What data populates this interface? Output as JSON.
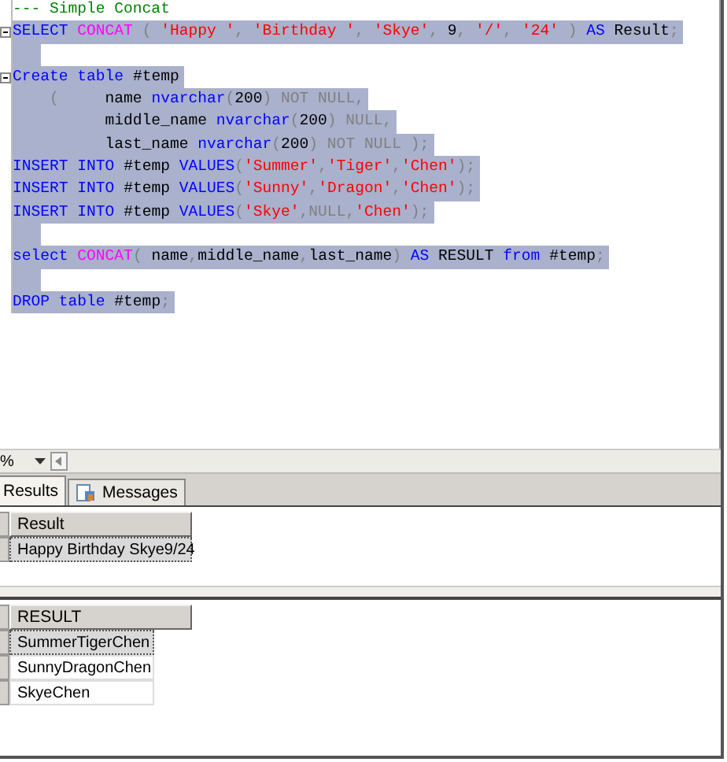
{
  "editor": {
    "lines": [
      {
        "selected": false,
        "tokens": [
          {
            "kind": "comment",
            "text": "--- Simple Concat"
          }
        ]
      },
      {
        "selected": true,
        "collapsible": true,
        "tokens": [
          {
            "kind": "keyword",
            "text": "SELECT "
          },
          {
            "kind": "function",
            "text": "CONCAT"
          },
          {
            "kind": "gray",
            "text": " ( "
          },
          {
            "kind": "string",
            "text": "'Happy '"
          },
          {
            "kind": "gray",
            "text": ", "
          },
          {
            "kind": "string",
            "text": "'Birthday '"
          },
          {
            "kind": "gray",
            "text": ", "
          },
          {
            "kind": "string",
            "text": "'Skye'"
          },
          {
            "kind": "gray",
            "text": ", "
          },
          {
            "kind": "plain",
            "text": "9"
          },
          {
            "kind": "gray",
            "text": ", "
          },
          {
            "kind": "string",
            "text": "'/'"
          },
          {
            "kind": "gray",
            "text": ", "
          },
          {
            "kind": "string",
            "text": "'24'"
          },
          {
            "kind": "gray",
            "text": " ) "
          },
          {
            "kind": "keyword",
            "text": "AS "
          },
          {
            "kind": "plain",
            "text": "Result"
          },
          {
            "kind": "gray",
            "text": ";"
          }
        ]
      },
      {
        "selected": true
      },
      {
        "selected": true,
        "collapsible": true,
        "tokens": [
          {
            "kind": "keyword",
            "text": "Create table "
          },
          {
            "kind": "plain",
            "text": "#temp"
          }
        ]
      },
      {
        "selected": true,
        "tokens": [
          {
            "kind": "gray",
            "text": "    (     "
          },
          {
            "kind": "plain",
            "text": "name "
          },
          {
            "kind": "keyword",
            "text": "nvarchar"
          },
          {
            "kind": "gray",
            "text": "("
          },
          {
            "kind": "plain",
            "text": "200"
          },
          {
            "kind": "gray",
            "text": ") NOT NULL,"
          }
        ]
      },
      {
        "selected": true,
        "tokens": [
          {
            "kind": "plain",
            "text": "          middle_name "
          },
          {
            "kind": "keyword",
            "text": "nvarchar"
          },
          {
            "kind": "gray",
            "text": "("
          },
          {
            "kind": "plain",
            "text": "200"
          },
          {
            "kind": "gray",
            "text": ") NULL,"
          }
        ]
      },
      {
        "selected": true,
        "tokens": [
          {
            "kind": "plain",
            "text": "          last_name "
          },
          {
            "kind": "keyword",
            "text": "nvarchar"
          },
          {
            "kind": "gray",
            "text": "("
          },
          {
            "kind": "plain",
            "text": "200"
          },
          {
            "kind": "gray",
            "text": ") NOT NULL );"
          }
        ]
      },
      {
        "selected": true,
        "tokens": [
          {
            "kind": "keyword",
            "text": "INSERT INTO "
          },
          {
            "kind": "plain",
            "text": "#temp "
          },
          {
            "kind": "keyword",
            "text": "VALUES"
          },
          {
            "kind": "gray",
            "text": "("
          },
          {
            "kind": "string",
            "text": "'Summer'"
          },
          {
            "kind": "gray",
            "text": ","
          },
          {
            "kind": "string",
            "text": "'Tiger'"
          },
          {
            "kind": "gray",
            "text": ","
          },
          {
            "kind": "string",
            "text": "'Chen'"
          },
          {
            "kind": "gray",
            "text": ");"
          }
        ]
      },
      {
        "selected": true,
        "tokens": [
          {
            "kind": "keyword",
            "text": "INSERT INTO "
          },
          {
            "kind": "plain",
            "text": "#temp "
          },
          {
            "kind": "keyword",
            "text": "VALUES"
          },
          {
            "kind": "gray",
            "text": "("
          },
          {
            "kind": "string",
            "text": "'Sunny'"
          },
          {
            "kind": "gray",
            "text": ","
          },
          {
            "kind": "string",
            "text": "'Dragon'"
          },
          {
            "kind": "gray",
            "text": ","
          },
          {
            "kind": "string",
            "text": "'Chen'"
          },
          {
            "kind": "gray",
            "text": ");"
          }
        ]
      },
      {
        "selected": true,
        "tokens": [
          {
            "kind": "keyword",
            "text": "INSERT INTO "
          },
          {
            "kind": "plain",
            "text": "#temp "
          },
          {
            "kind": "keyword",
            "text": "VALUES"
          },
          {
            "kind": "gray",
            "text": "("
          },
          {
            "kind": "string",
            "text": "'Skye'"
          },
          {
            "kind": "gray",
            "text": ",NULL,"
          },
          {
            "kind": "string",
            "text": "'Chen'"
          },
          {
            "kind": "gray",
            "text": ");"
          }
        ]
      },
      {
        "selected": true
      },
      {
        "selected": true,
        "tokens": [
          {
            "kind": "keyword",
            "text": "select "
          },
          {
            "kind": "function",
            "text": "CONCAT"
          },
          {
            "kind": "gray",
            "text": "( "
          },
          {
            "kind": "plain",
            "text": "name"
          },
          {
            "kind": "gray",
            "text": ","
          },
          {
            "kind": "plain",
            "text": "middle_name"
          },
          {
            "kind": "gray",
            "text": ","
          },
          {
            "kind": "plain",
            "text": "last_name"
          },
          {
            "kind": "gray",
            "text": ") "
          },
          {
            "kind": "keyword",
            "text": "AS "
          },
          {
            "kind": "plain",
            "text": "RESULT "
          },
          {
            "kind": "keyword",
            "text": "from "
          },
          {
            "kind": "plain",
            "text": "#temp"
          },
          {
            "kind": "gray",
            "text": ";"
          }
        ]
      },
      {
        "selected": true
      },
      {
        "selected": true,
        "tokens": [
          {
            "kind": "keyword",
            "text": "DROP table "
          },
          {
            "kind": "plain",
            "text": "#temp"
          },
          {
            "kind": "gray",
            "text": ";"
          }
        ]
      }
    ]
  },
  "zoom": {
    "value": "%"
  },
  "tabs": [
    {
      "label": "Results",
      "selected": true
    },
    {
      "label": "Messages",
      "selected": false
    }
  ],
  "grids": [
    {
      "column": "Result",
      "rows": [
        {
          "value": "Happy Birthday Skye9/24",
          "selected": true
        }
      ]
    },
    {
      "column": "RESULT",
      "rows": [
        {
          "value": "SummerTigerChen",
          "selected": true
        },
        {
          "value": "SunnyDragonChen",
          "selected": false
        },
        {
          "value": "SkyeChen",
          "selected": false
        }
      ]
    }
  ]
}
